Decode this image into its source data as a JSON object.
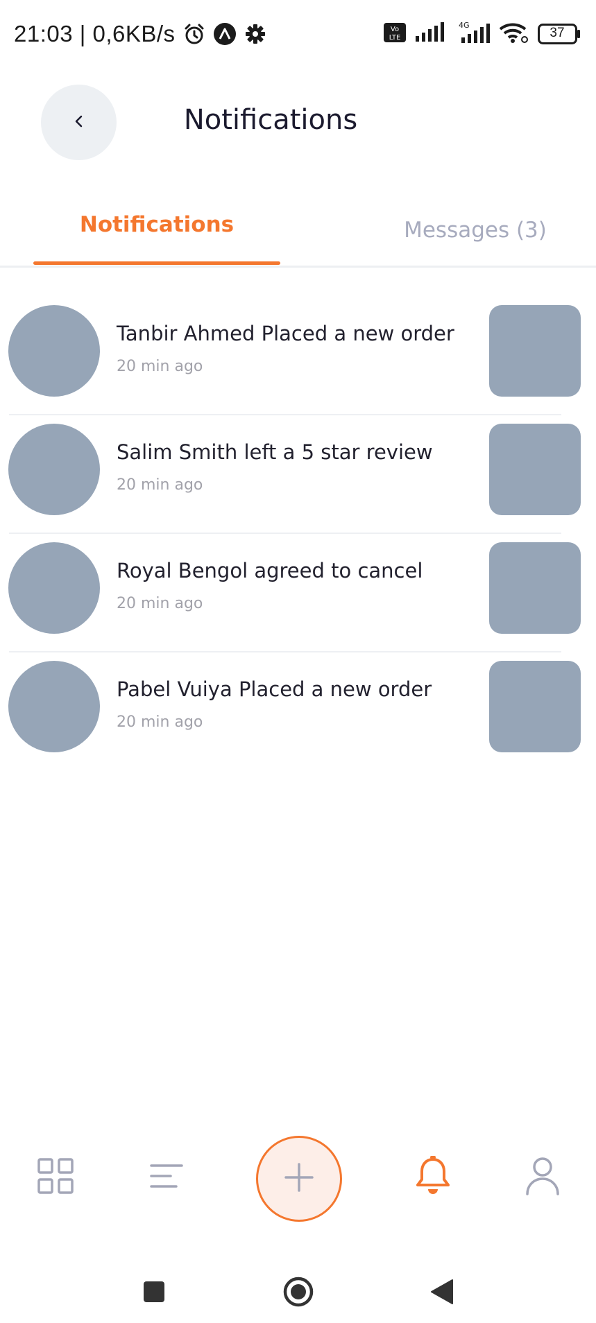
{
  "status_bar": {
    "time": "21:03 | 0,6KB/s",
    "battery": "37",
    "icons": [
      "alarm-icon",
      "app-notification-icon",
      "gear-icon",
      "volte-icon",
      "signal-icon",
      "signal-4g-icon",
      "wifi-icon",
      "battery-icon"
    ],
    "network_label": "4G",
    "volte_label_top": "Vo",
    "volte_label_bottom": "LTE"
  },
  "header": {
    "title": "Notifications",
    "back_icon": "chevron-left-icon"
  },
  "tabs": [
    {
      "label": "Notifications",
      "active": true
    },
    {
      "label": "Messages (3)",
      "active": false
    }
  ],
  "notifications": [
    {
      "title": "Tanbir Ahmed Placed a new order",
      "time": "20 min ago"
    },
    {
      "title": "Salim Smith left a 5 star review",
      "time": "20 min ago"
    },
    {
      "title": "Royal Bengol agreed to cancel",
      "time": "20 min ago"
    },
    {
      "title": "Pabel Vuiya Placed a new order",
      "time": "20 min ago"
    }
  ],
  "bottom_nav": {
    "items": [
      "dashboard-icon",
      "menu-lines-icon",
      "plus-icon",
      "bell-icon",
      "user-icon"
    ],
    "active": "bell-icon"
  },
  "colors": {
    "accent": "#f4772e",
    "placeholder": "#96a5b7",
    "muted": "#a7abbe"
  }
}
